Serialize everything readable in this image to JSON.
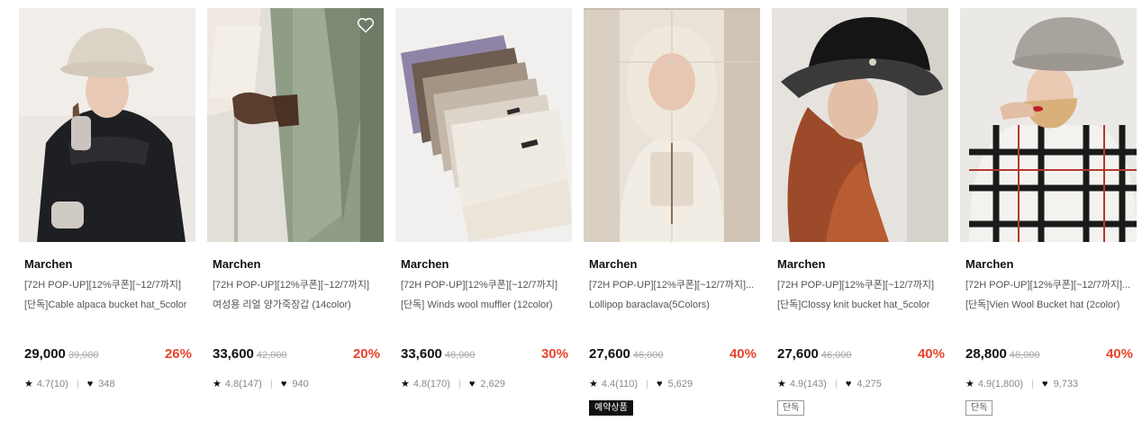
{
  "products": [
    {
      "brand": "Marchen",
      "promo": "[72H POP-UP][12%쿠폰][~12/7까지]",
      "name": "[단독]Cable alpaca bucket hat_5color",
      "price": "29,000",
      "original_price": "39,000",
      "discount": "26%",
      "rating": "4.7(10)",
      "likes": "348",
      "badge": ""
    },
    {
      "brand": "Marchen",
      "promo": "[72H POP-UP][12%쿠폰][~12/7까지]",
      "name": "여성용 리얼 양가죽장갑 (14color)",
      "price": "33,600",
      "original_price": "42,000",
      "discount": "20%",
      "rating": "4.8(147)",
      "likes": "940",
      "badge": ""
    },
    {
      "brand": "Marchen",
      "promo": "[72H POP-UP][12%쿠폰][~12/7까지]",
      "name": "[단독] Winds wool muffler (12color)",
      "price": "33,600",
      "original_price": "48,000",
      "discount": "30%",
      "rating": "4.8(170)",
      "likes": "2,629",
      "badge": ""
    },
    {
      "brand": "Marchen",
      "promo": "[72H POP-UP][12%쿠폰][~12/7까지]...",
      "name": "Lollipop baraclava(5Colors)",
      "price": "27,600",
      "original_price": "46,000",
      "discount": "40%",
      "rating": "4.4(110)",
      "likes": "5,629",
      "badge": "예약상품"
    },
    {
      "brand": "Marchen",
      "promo": "[72H POP-UP][12%쿠폰][~12/7까지]",
      "name": "[단독]Clossy knit bucket hat_5color",
      "price": "27,600",
      "original_price": "46,000",
      "discount": "40%",
      "rating": "4.9(143)",
      "likes": "4,275",
      "badge": "단독"
    },
    {
      "brand": "Marchen",
      "promo": "[72H POP-UP][12%쿠폰][~12/7까지]...",
      "name": "[단독]Vien Wool Bucket hat (2color)",
      "price": "28,800",
      "original_price": "48,000",
      "discount": "40%",
      "rating": "4.9(1,800)",
      "likes": "9,733",
      "badge": "단독"
    }
  ],
  "icons": {
    "rating": "star-icon",
    "likes": "heart-icon",
    "wishlist": "heart-outline-icon"
  },
  "colors": {
    "discount": "#e8432c",
    "badge_solid_bg": "#111111"
  }
}
